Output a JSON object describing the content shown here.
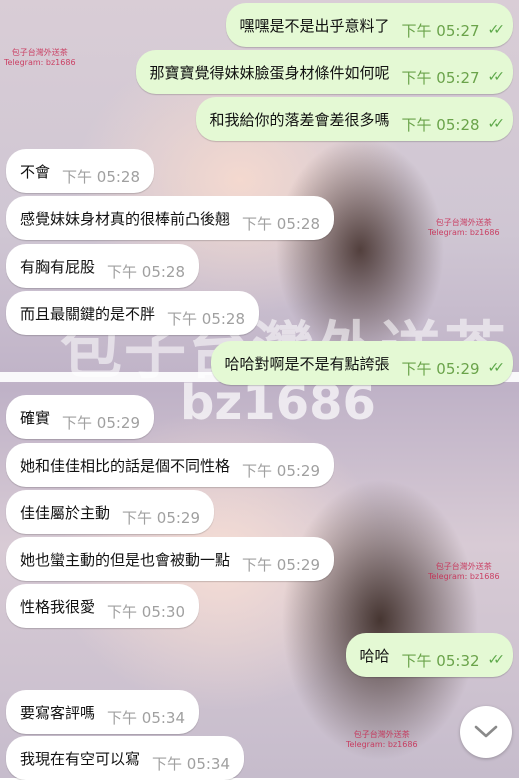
{
  "messages": [
    {
      "dir": "out",
      "text": "嘿嘿是不是出乎意料了",
      "time": "下午 05:27",
      "read": true
    },
    {
      "dir": "out",
      "text": "那寶寶覺得妹妹臉蛋身材條件如何呢",
      "time": "下午 05:27",
      "read": true
    },
    {
      "dir": "out",
      "text": "和我給你的落差會差很多嗎",
      "time": "下午 05:28",
      "read": true
    },
    {
      "dir": "in",
      "text": "不會",
      "time": "下午 05:28"
    },
    {
      "dir": "in",
      "text": "感覺妹妹身材真的很棒前凸後翹",
      "time": "下午 05:28"
    },
    {
      "dir": "in",
      "text": "有胸有屁股",
      "time": "下午 05:28"
    },
    {
      "dir": "in",
      "text": "而且最關鍵的是不胖",
      "time": "下午 05:28"
    },
    {
      "dir": "out",
      "text": "哈哈對啊是不是有點誇張",
      "time": "下午 05:29",
      "read": true
    },
    {
      "dir": "in",
      "text": "確實",
      "time": "下午 05:29"
    },
    {
      "dir": "in",
      "text": "她和佳佳相比的話是個不同性格",
      "time": "下午 05:29"
    },
    {
      "dir": "in",
      "text": "佳佳屬於主動",
      "time": "下午 05:29"
    },
    {
      "dir": "in",
      "text": "她也蠻主動的但是也會被動一點",
      "time": "下午 05:29"
    },
    {
      "dir": "in",
      "text": "性格我很愛",
      "time": "下午 05:30"
    },
    {
      "dir": "out",
      "text": "哈哈",
      "time": "下午 05:32",
      "read": true
    },
    {
      "dir": "in",
      "text": "要寫客評嗎",
      "time": "下午 05:34"
    },
    {
      "dir": "in",
      "text": "我現在有空可以寫",
      "time": "下午 05:34"
    }
  ],
  "watermarks": {
    "big": "包子台灣外送茶",
    "handle": "bz1686",
    "small_line1": "包子台灣外送茶",
    "small_line2": "Telegram: bz1686"
  },
  "icons": {
    "read_receipt": "double-check-icon",
    "scroll_down": "chevron-down-icon"
  },
  "colors": {
    "outgoing_bubble": "#e4f9d4",
    "incoming_bubble": "#ffffff",
    "outgoing_time": "#6aa34a",
    "incoming_time": "#a0a0a0"
  }
}
